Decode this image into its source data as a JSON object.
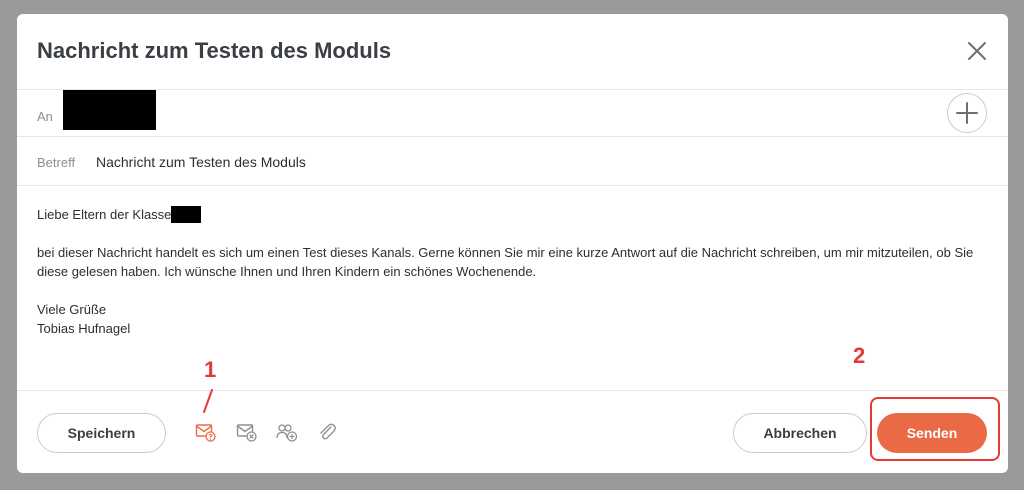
{
  "dialog": {
    "title": "Nachricht zum Testen des Moduls",
    "to_label": "An",
    "subject_label": "Betreff",
    "subject_value": "Nachricht zum Testen des Moduls"
  },
  "message": {
    "greeting": "Liebe Eltern der Klasse",
    "paragraph": "bei dieser Nachricht handelt es sich um einen Test dieses Kanals. Gerne können Sie mir eine kurze Antwort auf die Nachricht schreiben, um mir mitzuteilen, ob Sie diese gelesen haben. Ich wünsche Ihnen und Ihren Kindern ein schönes Wochenende.",
    "closing": "Viele Grüße",
    "signature": "Tobias Hufnagel"
  },
  "footer": {
    "save_label": "Speichern",
    "cancel_label": "Abbrechen",
    "send_label": "Senden"
  },
  "annotations": {
    "marker_1": "1",
    "marker_2": "2"
  },
  "colors": {
    "accent": "#ea6a45",
    "annotation": "#e53935"
  },
  "icons": {
    "close": "close-icon",
    "add_recipient": "plus-icon",
    "read_receipt": "mail-question-icon",
    "no_reply": "mail-x-icon",
    "group": "users-add-icon",
    "attachment": "paperclip-icon"
  }
}
